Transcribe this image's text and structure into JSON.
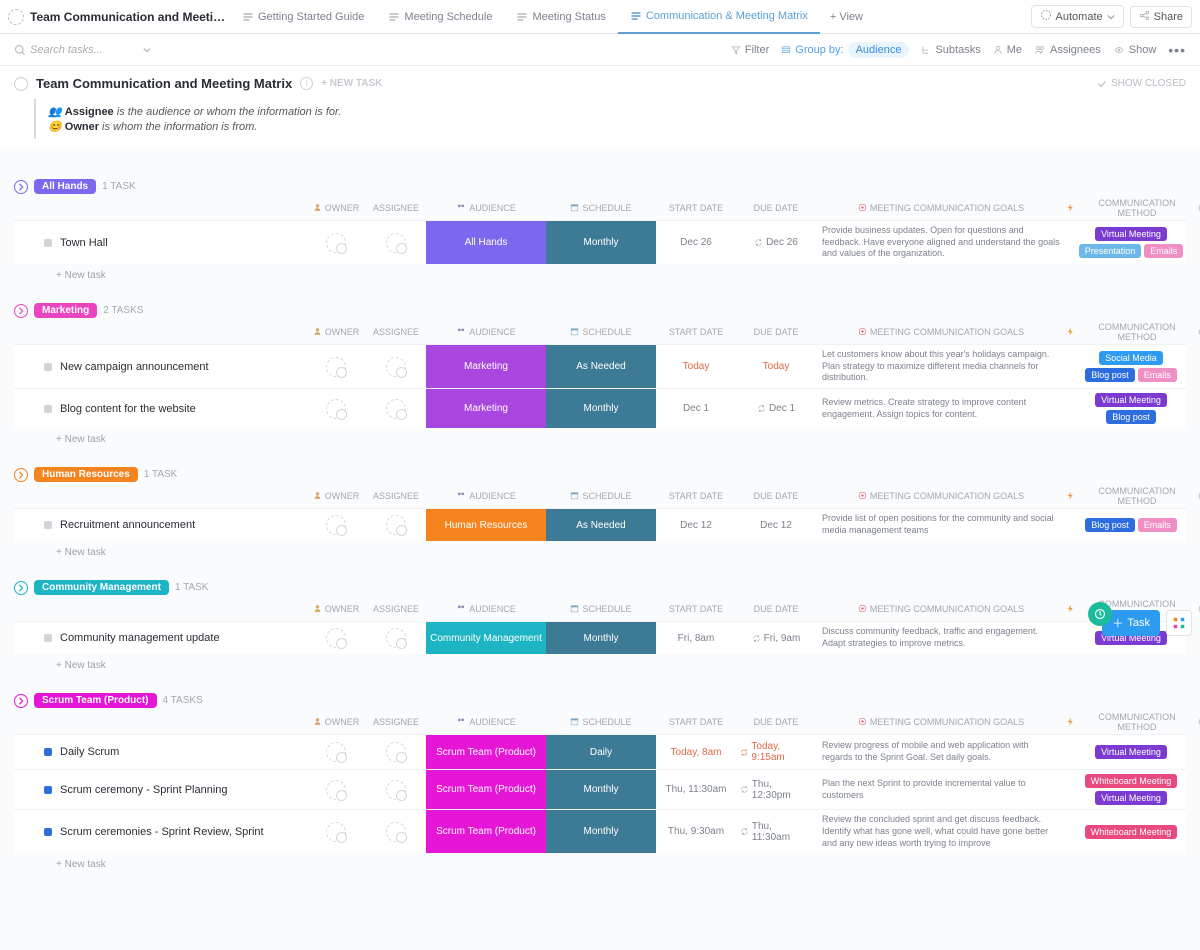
{
  "header": {
    "main_title": "Team Communication and Meeting Ma...",
    "tabs": [
      {
        "label": "Getting Started Guide",
        "active": false
      },
      {
        "label": "Meeting Schedule",
        "active": false
      },
      {
        "label": "Meeting Status",
        "active": false
      },
      {
        "label": "Communication & Meeting Matrix",
        "active": true
      }
    ],
    "add_view": "+ View",
    "automate": "Automate",
    "share": "Share"
  },
  "toolbar": {
    "search_placeholder": "Search tasks...",
    "filter": "Filter",
    "group_by": "Group by:",
    "group_value": "Audience",
    "subtasks": "Subtasks",
    "me": "Me",
    "assignees": "Assignees",
    "show": "Show"
  },
  "page": {
    "title": "Team Communication and Meeting Matrix",
    "new_task": "+ NEW TASK",
    "show_closed": "SHOW CLOSED",
    "legend_assignee_label": "Assignee",
    "legend_assignee_text": " is the audience or whom the information is for.",
    "legend_owner_label": "Owner",
    "legend_owner_text": " is whom the information is from.",
    "new_task_link": "+ New task"
  },
  "columns": {
    "owner": "OWNER",
    "assignee": "ASSIGNEE",
    "audience": "AUDIENCE",
    "schedule": "SCHEDULE",
    "start": "START DATE",
    "due": "DUE DATE",
    "goals": "MEETING COMMUNICATION GOALS",
    "method": "COMMUNICATION METHOD"
  },
  "tag_colors": {
    "Virtual Meeting": "#7b3bd1",
    "Presentation": "#6db8e8",
    "Emails": "#f08fc6",
    "Social Media": "#2d9bf0",
    "Blog post": "#2d6de0",
    "Whiteboard Meeting": "#e84a7d"
  },
  "groups": [
    {
      "name": "All Hands",
      "color": "#7b68ee",
      "caret": "#7b68ee",
      "count": "1 TASK",
      "rows": [
        {
          "sq": "#d0d3d8",
          "name": "Town Hall",
          "aud": "All Hands",
          "aud_color": "#7b68ee",
          "sched": "Monthly",
          "start": "Dec 26",
          "due": "Dec 26",
          "due_icon": true,
          "goals": "Provide business updates. Open for questions and feedback. Have everyone aligned and understand the goals and values of the organization.",
          "tags": [
            [
              "Virtual Meeting"
            ],
            [
              "Presentation",
              "Emails"
            ]
          ]
        }
      ]
    },
    {
      "name": "Marketing",
      "color": "#e945c1",
      "caret": "#e945c1",
      "count": "2 TASKS",
      "rows": [
        {
          "sq": "#d0d3d8",
          "name": "New campaign announcement",
          "aud": "Marketing",
          "aud_color": "#a946e0",
          "sched": "As Needed",
          "start": "Today",
          "start_today": true,
          "due": "Today",
          "due_today": true,
          "goals": "Let customers know about this year's holidays campaign. Plan strategy to maximize different media channels for distribution.",
          "tags": [
            [
              "Social Media"
            ],
            [
              "Blog post",
              "Emails"
            ]
          ]
        },
        {
          "sq": "#d0d3d8",
          "name": "Blog content for the website",
          "aud": "Marketing",
          "aud_color": "#a946e0",
          "sched": "Monthly",
          "start": "Dec 1",
          "due": "Dec 1",
          "due_icon": true,
          "goals": "Review metrics. Create strategy to improve content engagement. Assign topics for content.",
          "tags": [
            [
              "Virtual Meeting"
            ],
            [
              "Blog post"
            ]
          ]
        }
      ]
    },
    {
      "name": "Human Resources",
      "color": "#f5841f",
      "caret": "#f5841f",
      "count": "1 TASK",
      "rows": [
        {
          "sq": "#d0d3d8",
          "name": "Recruitment announcement",
          "aud": "Human Resources",
          "aud_color": "#f5841f",
          "sched": "As Needed",
          "start": "Dec 12",
          "due": "Dec 12",
          "goals": "Provide list of open positions for the community and social media management teams",
          "tags": [
            [
              "Blog post",
              "Emails"
            ]
          ]
        }
      ]
    },
    {
      "name": "Community Management",
      "color": "#1db5c4",
      "caret": "#1db5c4",
      "count": "1 TASK",
      "rows": [
        {
          "sq": "#d0d3d8",
          "name": "Community management update",
          "aud": "Community Management",
          "aud_color": "#1db5c4",
          "sched": "Monthly",
          "start": "Fri, 8am",
          "due": "Fri, 9am",
          "due_icon": true,
          "goals": "Discuss community feedback, traffic and engagement. Adapt strategies to improve metrics.",
          "tags": [
            [
              "Virtual Meeting"
            ]
          ]
        }
      ]
    },
    {
      "name": "Scrum Team (Product)",
      "color": "#e516d5",
      "caret": "#e516d5",
      "count": "4 TASKS",
      "rows": [
        {
          "sq": "#2d6de0",
          "name": "Daily Scrum",
          "aud": "Scrum Team (Product)",
          "aud_color": "#e516d5",
          "sched": "Daily",
          "start": "Today, 8am",
          "start_today": true,
          "due": "Today, 9:15am",
          "due_today": true,
          "due_icon": true,
          "goals": "Review progress of mobile and web application with regards to the Sprint Goal. Set daily goals.",
          "tags": [
            [
              "Virtual Meeting"
            ]
          ]
        },
        {
          "sq": "#2d6de0",
          "name": "Scrum ceremony - Sprint Planning",
          "aud": "Scrum Team (Product)",
          "aud_color": "#e516d5",
          "sched": "Monthly",
          "start": "Thu, 11:30am",
          "due": "Thu, 12:30pm",
          "due_icon": true,
          "goals": "Plan the next Sprint to provide incremental value to customers",
          "tags": [
            [
              "Whiteboard Meeting"
            ],
            [
              "Virtual Meeting"
            ]
          ]
        },
        {
          "sq": "#2d6de0",
          "name": "Scrum ceremonies - Sprint Review, Sprint",
          "aud": "Scrum Team (Product)",
          "aud_color": "#e516d5",
          "sched": "Monthly",
          "start": "Thu, 9:30am",
          "due": "Thu, 11:30am",
          "due_icon": true,
          "goals": "Review the concluded sprint and get discuss feedback. Identify what has gone well, what could have gone better and any new ideas worth trying to improve",
          "tags": [
            [
              "Whiteboard Meeting"
            ]
          ]
        }
      ]
    }
  ]
}
